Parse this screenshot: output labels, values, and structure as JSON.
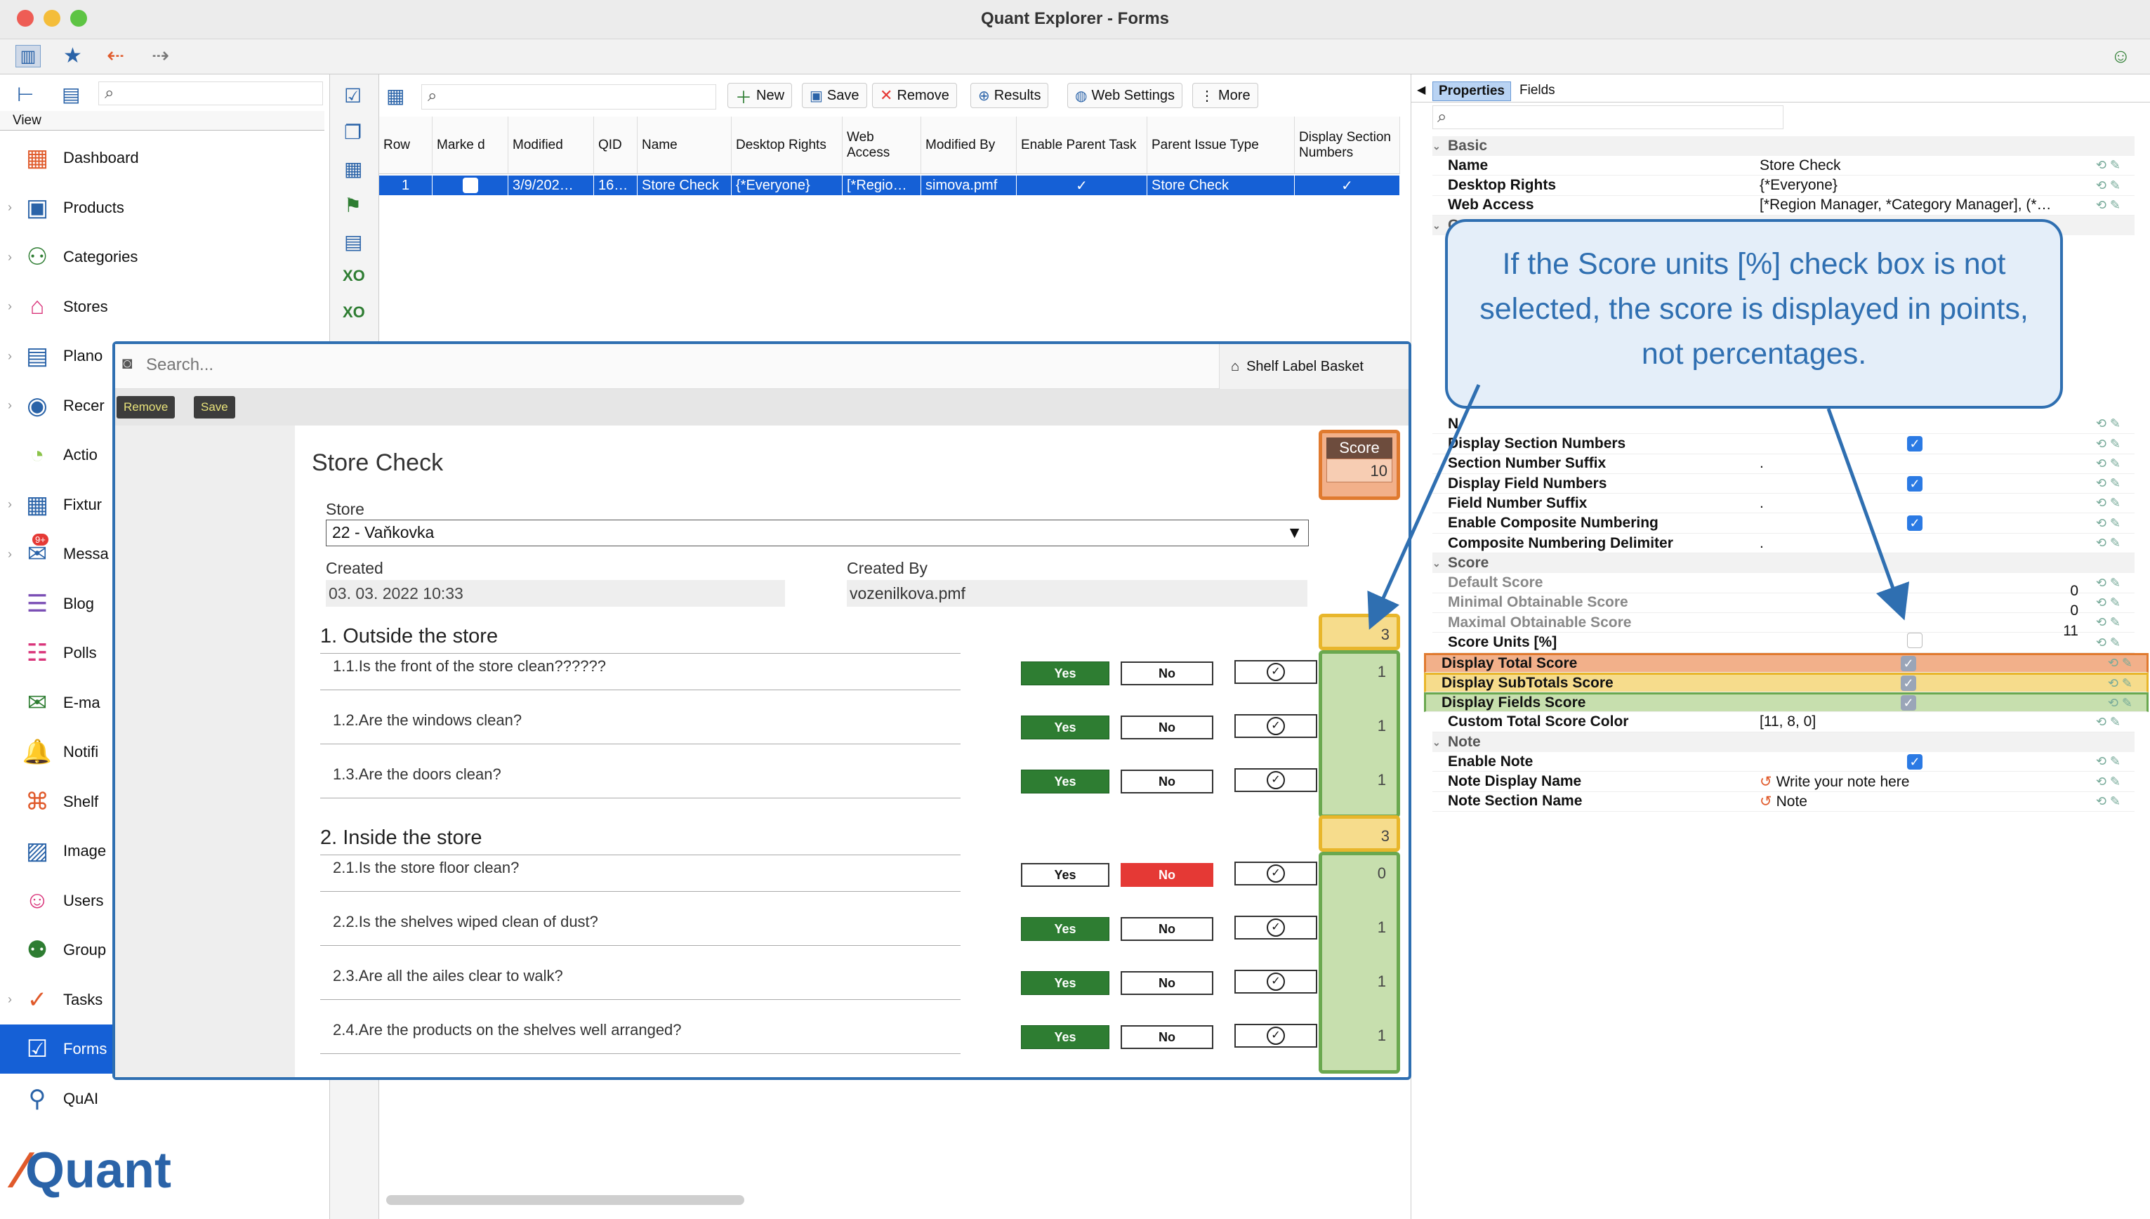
{
  "window": {
    "title": "Quant Explorer - Forms"
  },
  "sidebar": {
    "view_label": "View",
    "items": [
      {
        "label": "Dashboard",
        "icon": "dashboard-icon",
        "glyph": "▦",
        "color": "#e05a2b"
      },
      {
        "label": "Products",
        "icon": "products-icon",
        "glyph": "▣",
        "color": "#2a63a8"
      },
      {
        "label": "Categories",
        "icon": "categories-icon",
        "glyph": "⚇",
        "color": "#2e7d32"
      },
      {
        "label": "Stores",
        "icon": "stores-icon",
        "glyph": "⌂",
        "color": "#d9347a"
      },
      {
        "label": "Plano",
        "icon": "planogram-icon",
        "glyph": "▤",
        "color": "#2a63a8"
      },
      {
        "label": "Recer",
        "icon": "camera-icon",
        "glyph": "◉",
        "color": "#2a63a8"
      },
      {
        "label": "Actio",
        "icon": "actions-icon",
        "glyph": "◔",
        "color": "#8bc34a"
      },
      {
        "label": "Fixtur",
        "icon": "fixtures-icon",
        "glyph": "▦",
        "color": "#2a63a8"
      },
      {
        "label": "Messa",
        "icon": "messages-icon",
        "glyph": "✉",
        "color": "#2a63a8",
        "badge": "9+"
      },
      {
        "label": "Blog",
        "icon": "blog-icon",
        "glyph": "☰",
        "color": "#7b4fb5"
      },
      {
        "label": "Polls",
        "icon": "polls-icon",
        "glyph": "☷",
        "color": "#d9347a"
      },
      {
        "label": "E-ma",
        "icon": "email-icon",
        "glyph": "✉",
        "color": "#2e7d32"
      },
      {
        "label": "Notifi",
        "icon": "notifications-icon",
        "glyph": "🔔",
        "color": "#2a63a8"
      },
      {
        "label": "Shelf",
        "icon": "shelf-label-icon",
        "glyph": "⌘",
        "color": "#e05a2b"
      },
      {
        "label": "Image",
        "icon": "image-icon",
        "glyph": "▨",
        "color": "#2a63a8"
      },
      {
        "label": "Users",
        "icon": "users-icon",
        "glyph": "☺",
        "color": "#d9347a"
      },
      {
        "label": "Group",
        "icon": "groups-icon",
        "glyph": "⚉",
        "color": "#2e7d32"
      },
      {
        "label": "Tasks",
        "icon": "tasks-icon",
        "glyph": "✓",
        "color": "#e05a2b"
      },
      {
        "label": "Forms",
        "icon": "forms-icon",
        "glyph": "☑",
        "color": "#ffffff",
        "active": true
      },
      {
        "label": "QuAI",
        "icon": "quai-icon",
        "glyph": "⚲",
        "color": "#2a63a8"
      }
    ],
    "logo_text": "Quant"
  },
  "middle_toolbar": {
    "new": "New",
    "save": "Save",
    "remove": "Remove",
    "results": "Results",
    "web_settings": "Web Settings",
    "more": "More"
  },
  "grid": {
    "headers": [
      "Row",
      "Marke d",
      "Modified",
      "QID",
      "Name",
      "Desktop Rights",
      "Web Access",
      "Modified By",
      "Enable Parent Task",
      "Parent Issue Type",
      "Display Section Numbers"
    ],
    "sort_index": "1",
    "row": [
      "1",
      "",
      "3/9/202…",
      "16…",
      "Store Check",
      "{*Everyone}",
      "[*Regio…",
      "simova.pmf",
      "✓",
      "Store Check",
      "✓"
    ]
  },
  "properties": {
    "tabs": [
      "Properties",
      "Fields"
    ],
    "rows": [
      {
        "type": "sec",
        "key": "Basic"
      },
      {
        "key": "Name",
        "value": "Store Check"
      },
      {
        "key": "Desktop Rights",
        "value": "{*Everyone}"
      },
      {
        "key": "Web Access",
        "value": "[*Region Manager, *Category Manager], (*…"
      },
      {
        "type": "sec",
        "key": "G"
      },
      {
        "type": "gap"
      },
      {
        "type": "gap"
      },
      {
        "type": "gap"
      },
      {
        "type": "gap"
      },
      {
        "type": "gap"
      },
      {
        "type": "gap"
      },
      {
        "type": "gap"
      },
      {
        "type": "gap"
      },
      {
        "type": "gap"
      },
      {
        "key": "N",
        "value": ""
      },
      {
        "key": "Display Section Numbers",
        "check": "on"
      },
      {
        "key": "Section Number Suffix",
        "value": "."
      },
      {
        "key": "Display Field Numbers",
        "check": "on"
      },
      {
        "key": "Field Number Suffix",
        "value": "."
      },
      {
        "key": "Enable Composite Numbering",
        "check": "on"
      },
      {
        "key": "Composite Numbering Delimiter",
        "value": "."
      },
      {
        "type": "sec",
        "key": "Score"
      },
      {
        "key": "Default Score",
        "num": "0",
        "grey": true
      },
      {
        "key": "Minimal Obtainable Score",
        "num": "0",
        "grey": true
      },
      {
        "key": "Maximal Obtainable Score",
        "num": "11",
        "grey": true
      },
      {
        "key": "Score Units [%]",
        "check": "off"
      },
      {
        "key": "Display Total Score",
        "check": "dim",
        "hl": "#f2b08a",
        "hlb": "#e07a2f"
      },
      {
        "key": "Display SubTotals Score",
        "check": "dim",
        "hl": "#f6dc8c",
        "hlb": "#e8b62b"
      },
      {
        "key": "Display Fields Score",
        "check": "dim",
        "hl": "#c7dfae",
        "hlb": "#6aa84f"
      },
      {
        "key": "Custom Total Score Color",
        "value": "[11, 8, 0]"
      },
      {
        "type": "sec",
        "key": "Note"
      },
      {
        "key": "Enable Note",
        "check": "on"
      },
      {
        "key": "Note Display Name",
        "value": "Write your note here",
        "icon": "↺"
      },
      {
        "key": "Note Section Name",
        "value": "Note",
        "icon": "↺"
      }
    ]
  },
  "form": {
    "search_placeholder": "Search...",
    "shelf_label_basket": "Shelf Label Basket",
    "remove": "Remove",
    "save": "Save",
    "title": "Store Check",
    "score_label": "Score",
    "score_value": "10",
    "store_label": "Store",
    "store_value": "22 - Vaňkovka",
    "created_label": "Created",
    "created_value": "03. 03. 2022 10:33",
    "created_by_label": "Created By",
    "created_by_value": "vozenilkova.pmf",
    "sections": [
      {
        "title": "1. Outside the store",
        "subtotal": "3",
        "questions": [
          {
            "text": "1.1.Is the front of the store clean??????",
            "answer": "Yes",
            "score": "1"
          },
          {
            "text": "1.2.Are the windows clean?",
            "answer": "Yes",
            "score": "1"
          },
          {
            "text": "1.3.Are the doors clean?",
            "answer": "Yes",
            "score": "1"
          }
        ]
      },
      {
        "title": "2. Inside the store",
        "subtotal": "3",
        "questions": [
          {
            "text": "2.1.Is the store floor clean?",
            "answer": "No",
            "score": "0"
          },
          {
            "text": "2.2.Is the shelves wiped clean of dust?",
            "answer": "Yes",
            "score": "1"
          },
          {
            "text": "2.3.Are all the ailes clear to walk?",
            "answer": "Yes",
            "score": "1"
          },
          {
            "text": "2.4.Are the products on the shelves well arranged?",
            "answer": "Yes",
            "score": "1"
          }
        ]
      }
    ],
    "yes": "Yes",
    "no": "No"
  },
  "callout": {
    "text": "If the Score units [%] check box is not selected, the score is displayed in points, not percentages."
  },
  "colors": {
    "accent": "#1560d6",
    "callout": "#2f6fb1",
    "total": "#e07a2f",
    "subtotal": "#e8b62b",
    "fields": "#6aa84f"
  }
}
